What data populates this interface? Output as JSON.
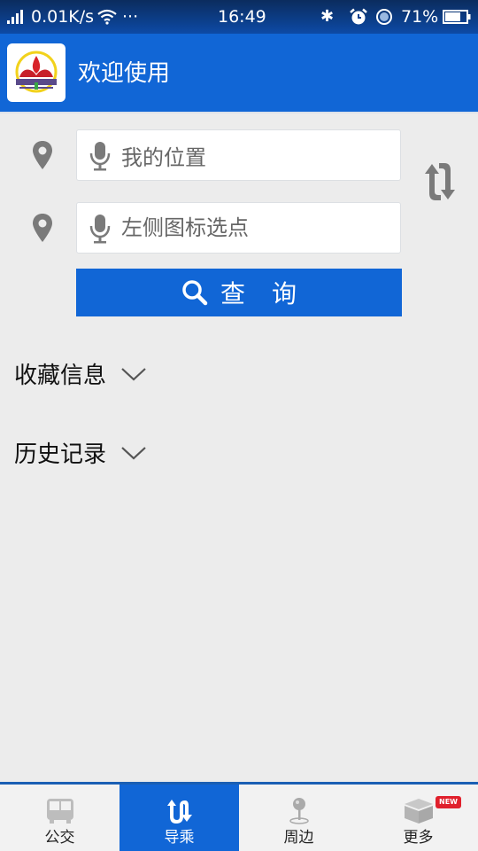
{
  "status_bar": {
    "network_speed": "0.01K/s",
    "more": "···",
    "time": "16:49",
    "battery": "71%"
  },
  "app_bar": {
    "title": "欢迎使用"
  },
  "route": {
    "origin_value": "我的位置",
    "destination_placeholder": "左侧图标选点",
    "search_label": "查询"
  },
  "sections": {
    "favorites": "收藏信息",
    "history": "历史记录"
  },
  "tabs": [
    {
      "label": "公交",
      "icon": "bus-icon",
      "active": false
    },
    {
      "label": "导乘",
      "icon": "route-icon",
      "active": true
    },
    {
      "label": "周边",
      "icon": "map-pin-icon",
      "active": false
    },
    {
      "label": "更多",
      "icon": "box-icon",
      "active": false
    }
  ],
  "badge": "NEW",
  "colors": {
    "primary": "#1166d6",
    "background": "#ececec",
    "badge": "#e0202c"
  }
}
